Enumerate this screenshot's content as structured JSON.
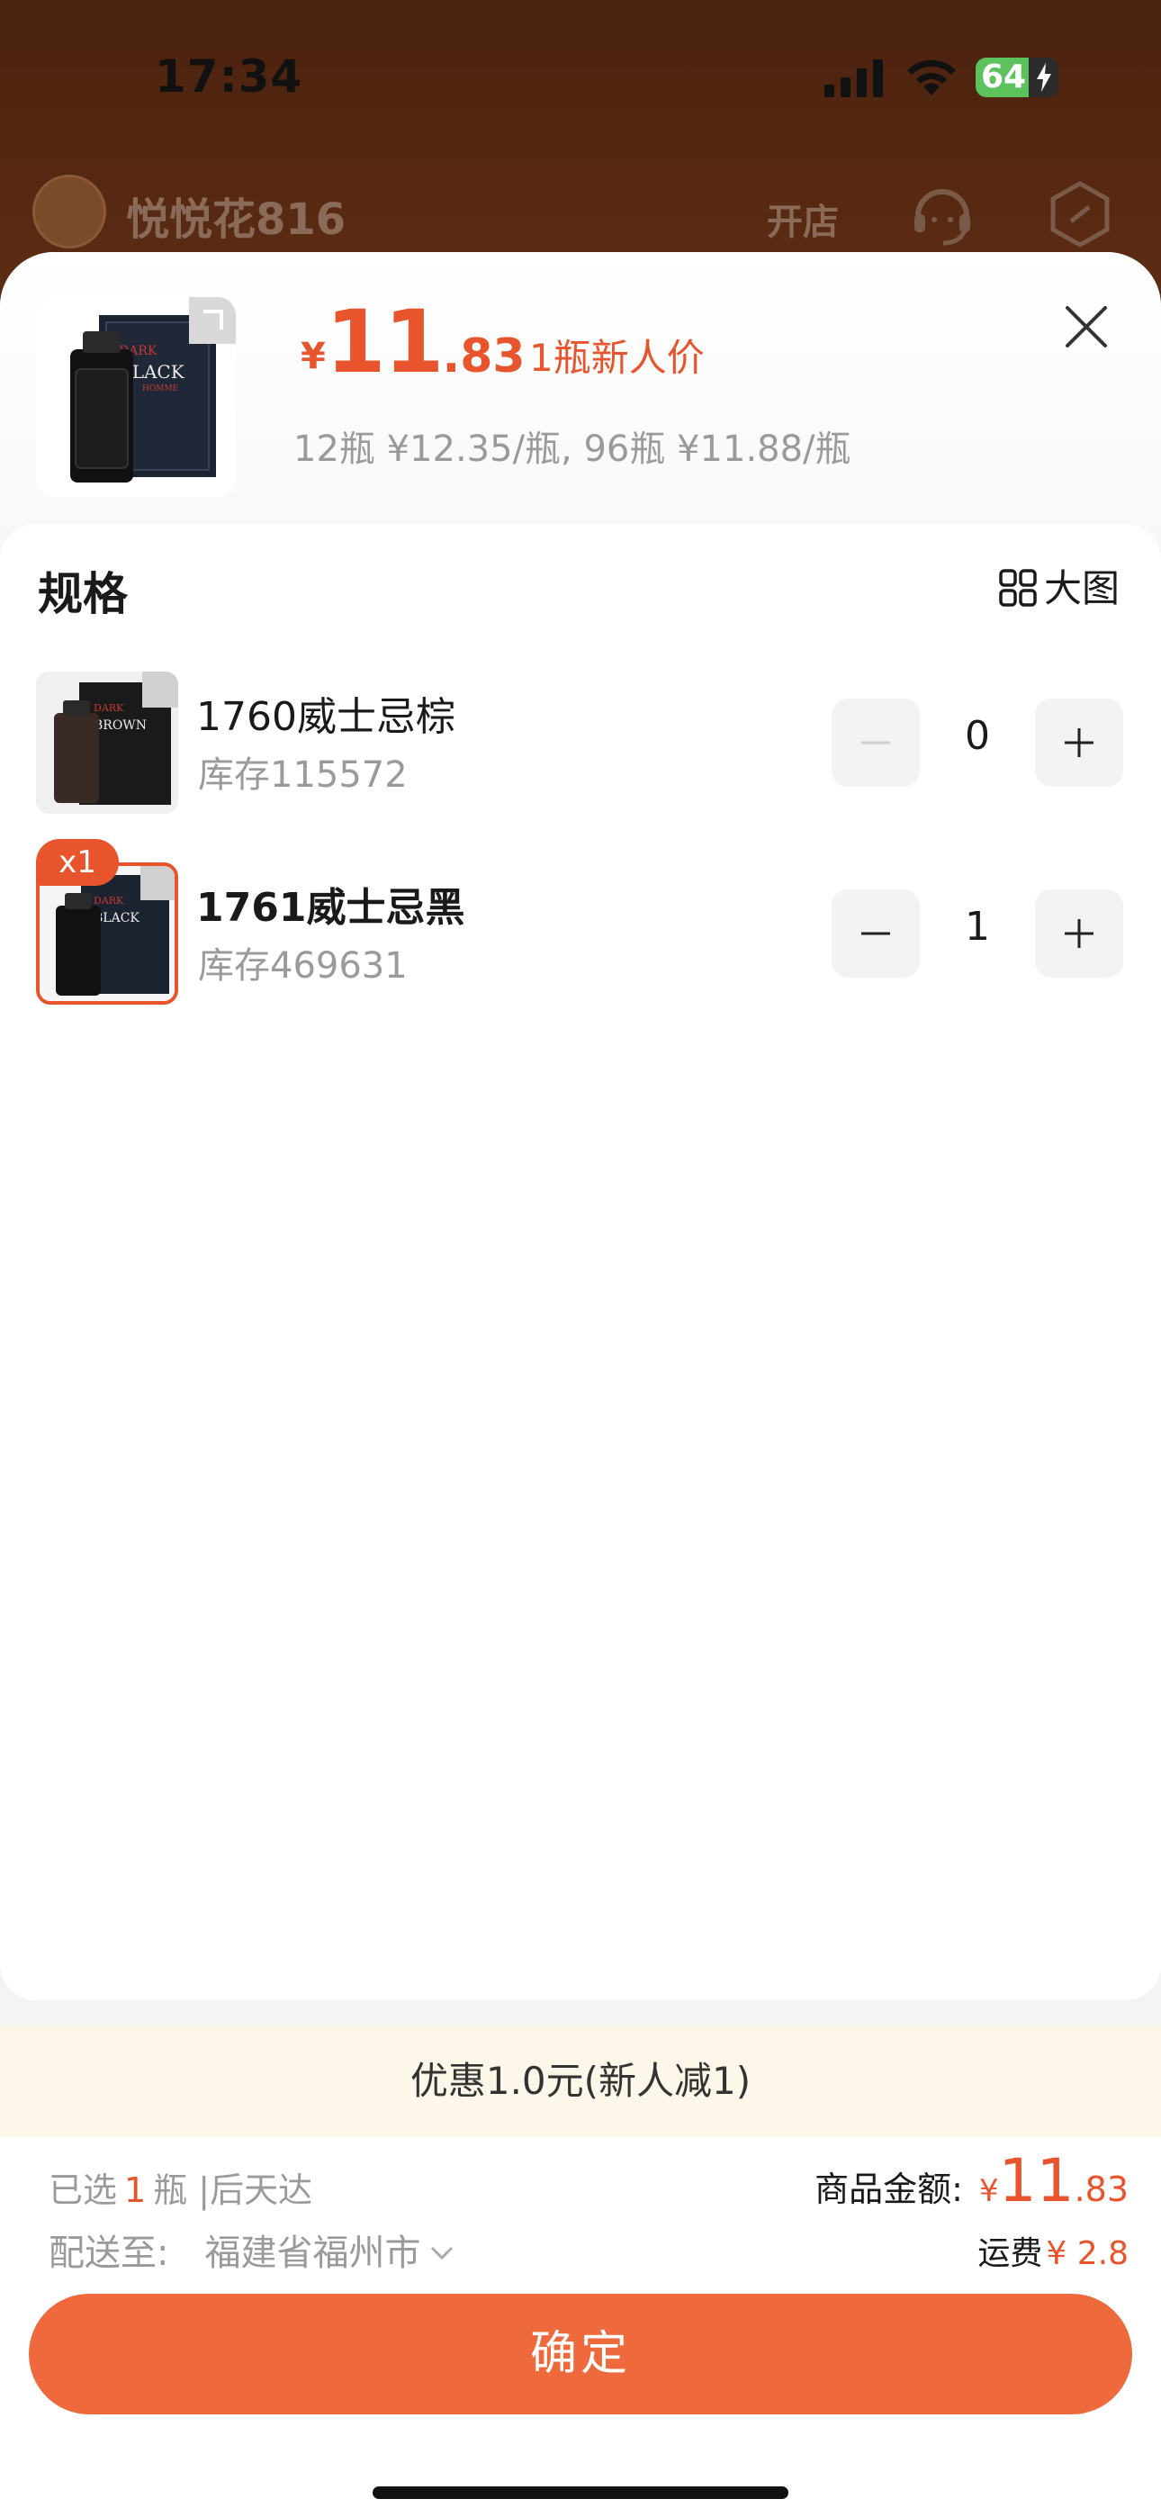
{
  "status_bar": {
    "time": "17:34",
    "battery": "64"
  },
  "shop": {
    "name": "悦悦花816",
    "open_shop_label": "开店"
  },
  "product": {
    "currency": "¥",
    "price_int": "11",
    "price_dec": ".83",
    "price_tag": "1瓶新人价",
    "tier_pricing": "12瓶 ¥12.35/瓶, 96瓶 ¥11.88/瓶"
  },
  "spec": {
    "title": "规格",
    "big_image_label": "大图",
    "items": [
      {
        "name": "1760威士忌棕",
        "stock": "库存115572",
        "quantity": "0",
        "selected": false
      },
      {
        "name": "1761威士忌黑",
        "stock": "库存469631",
        "quantity": "1",
        "selected": true,
        "badge": "x1"
      }
    ]
  },
  "discount": {
    "text": "优惠1.0元(新人减1)"
  },
  "footer": {
    "selected_prefix": "已选",
    "selected_count": "1",
    "selected_suffix": "瓶 |后天达",
    "ship_to_label": "配送至:",
    "ship_to_address": "福建省福州市",
    "goods_amount_label": "商品金额:",
    "goods_amount_currency": "¥",
    "goods_amount_int": "11",
    "goods_amount_dec": ".83",
    "freight_label": "运费",
    "freight_value": "¥ 2.8"
  },
  "confirm_label": "确定",
  "colors": {
    "accent": "#e8542c",
    "button": "#ee6a3c",
    "discount_bg": "#fdf7e9"
  }
}
